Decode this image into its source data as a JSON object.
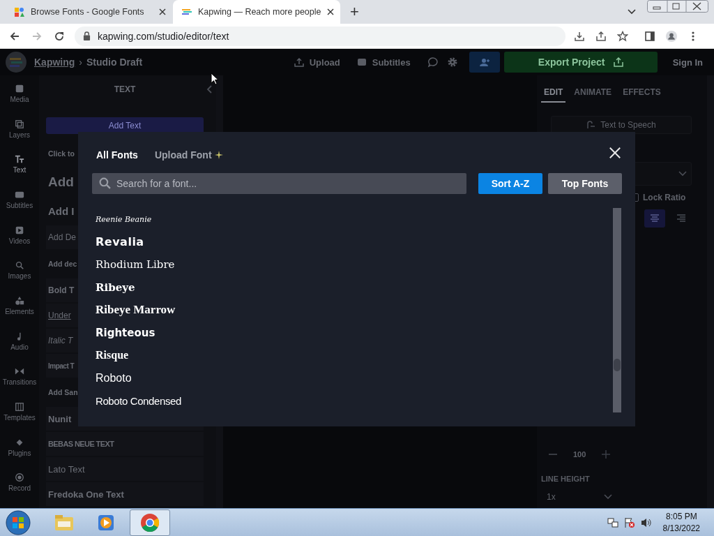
{
  "browser": {
    "tabs": [
      {
        "title": "Browse Fonts - Google Fonts",
        "selected": false
      },
      {
        "title": "Kapwing — Reach more people",
        "selected": true
      }
    ],
    "new_tab": "+",
    "url": "kapwing.com/studio/editor/text",
    "forward": {
      "disabled": true
    }
  },
  "topbar": {
    "brand": "Kapwing",
    "separator": "›",
    "project": "Studio Draft",
    "upload": "Upload",
    "subtitles": "Subtitles",
    "export": "Export Project",
    "sign_in": "Sign In"
  },
  "rail": [
    {
      "label": "Media",
      "selected": false
    },
    {
      "label": "Layers",
      "selected": false
    },
    {
      "label": "Text",
      "selected": true
    },
    {
      "label": "Subtitles",
      "selected": false
    },
    {
      "label": "Videos",
      "selected": false
    },
    {
      "label": "Images",
      "selected": false
    },
    {
      "label": "Elements",
      "selected": false
    },
    {
      "label": "Audio",
      "selected": false
    },
    {
      "label": "Transitions",
      "selected": false
    },
    {
      "label": "Templates",
      "selected": false
    },
    {
      "label": "Plugins",
      "selected": false
    },
    {
      "label": "Record",
      "selected": false
    }
  ],
  "left_panel": {
    "title": "TEXT",
    "add_button": "Add Text",
    "items": [
      {
        "kind": "label",
        "text": "Click to"
      },
      {
        "kind": "heading",
        "text": "Add"
      },
      {
        "kind": "subheading",
        "text": "Add I"
      },
      {
        "kind": "body",
        "text": "Add De"
      },
      {
        "kind": "label",
        "text": "Add dec"
      },
      {
        "kind": "bold",
        "text": "Bold T"
      },
      {
        "kind": "underline",
        "text": "Under"
      },
      {
        "kind": "italic",
        "text": "Italic T"
      },
      {
        "kind": "impact",
        "text": "Impact T"
      },
      {
        "kind": "label",
        "text": "Add San"
      },
      {
        "kind": "nunito",
        "text": "Nunit"
      },
      {
        "kind": "bebas",
        "text": "BEBAS NEUE TEXT"
      },
      {
        "kind": "lato",
        "text": "Lato Text"
      },
      {
        "kind": "fredoka",
        "text": "Fredoka One Text"
      }
    ]
  },
  "right_panel": {
    "tabs": [
      {
        "label": "EDIT",
        "selected": true
      },
      {
        "label": "ANIMATE",
        "selected": false
      },
      {
        "label": "EFFECTS",
        "selected": false
      }
    ],
    "tts": "Text to Speech",
    "lock_ratio": {
      "label": "Lock Ratio",
      "checked": false
    },
    "align_buttons": [
      {
        "selected": true
      },
      {
        "selected": false
      }
    ],
    "size": "100",
    "line_height_label": "LINE HEIGHT",
    "line_height": "1x"
  },
  "font_modal": {
    "tabs": [
      {
        "label": "All Fonts",
        "selected": true
      },
      {
        "label": "Upload Font",
        "selected": false
      }
    ],
    "search": {
      "placeholder": "Search for a font..."
    },
    "sort_buttons": [
      {
        "label": "Sort A-Z",
        "selected": true
      },
      {
        "label": "Top Fonts",
        "selected": false
      }
    ],
    "fonts": [
      "Reenie Beanie",
      "Revalia",
      "Rhodium Libre",
      "Ribeye",
      "Ribeye Marrow",
      "Righteous",
      "Risque",
      "Roboto",
      "Roboto Condensed"
    ]
  },
  "taskbar": {
    "apps": [
      {
        "kind": "explorer",
        "selected": false
      },
      {
        "kind": "media",
        "selected": false
      },
      {
        "kind": "chrome",
        "selected": true
      }
    ],
    "time": "8:05 PM",
    "date": "8/13/2022"
  }
}
